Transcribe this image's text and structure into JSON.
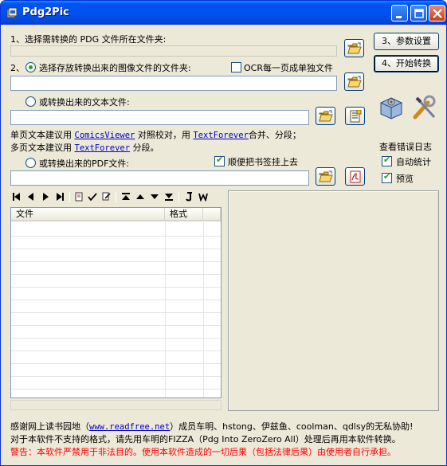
{
  "window": {
    "title": "Pdg2Pic"
  },
  "source": {
    "label": "1、选择需转换的 PDG 文件所在文件夹:",
    "value": ""
  },
  "image_out": {
    "number": "2、",
    "label": "选择存放转换出来的图像文件的文件夹:",
    "value": "",
    "selected": true
  },
  "ocr": {
    "label": "OCR每一页成单独文件",
    "checked": false
  },
  "text_out": {
    "label": "或转换出来的文本文件:",
    "value": "",
    "selected": false
  },
  "hints": {
    "line1_a": "单页文本建议用",
    "line1_link1": "ComicsViewer",
    "line1_b": "对照校对，用",
    "line1_link2": "TextForever",
    "line1_c": "合并、分段；",
    "line2_a": "多页文本建议用",
    "line2_link": "TextForever",
    "line2_b": "分段。"
  },
  "pdf_out": {
    "label": "或转换出来的PDF文件:",
    "value": "",
    "selected": false
  },
  "bookmark": {
    "label": "顺便把书签挂上去",
    "checked": true
  },
  "buttons": {
    "params": "3、参数设置",
    "start": "4、开始转换"
  },
  "side": {
    "error_log": "查看错误日志",
    "auto_stat": {
      "label": "自动统计",
      "checked": true
    },
    "preview": {
      "label": "预览",
      "checked": true
    }
  },
  "list": {
    "columns": [
      "文件",
      "格式"
    ],
    "rows": []
  },
  "footer": {
    "line1_a": "感谢网上读书园地（",
    "line1_link": "www.readfree.net",
    "line1_b": "）成员车明、hstong、伊兹鱼、coolman、qdlsy的无私协助!",
    "line2": "对于本软件不支持的格式，请先用车明的FIZZA（Pdg Into ZeroZero All）处理后再用本软件转换。",
    "line3": "警告：本软件严禁用于非法目的。使用本软件造成的一切后果（包括法律后果）由使用者自行承担。",
    "warning_color": "#FF0000"
  }
}
